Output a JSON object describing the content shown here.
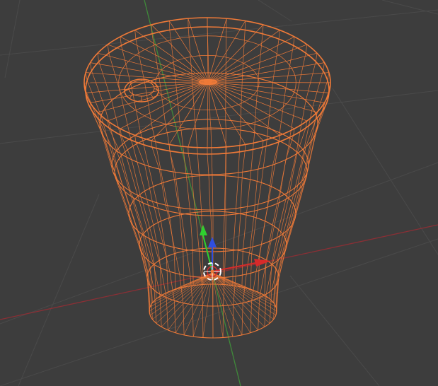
{
  "viewport": {
    "background": "#3d3d3d",
    "grid_color": "#4a4a4a",
    "axis_colors": {
      "x_axis_line": "#8a2f35",
      "y_axis_line": "#3f8a3a"
    }
  },
  "object": {
    "kind": "cylinder-mesh",
    "display": "wireframe",
    "selected": true,
    "wire_color": "#f07a38"
  },
  "gizmo": {
    "kind": "translate-gizmo",
    "x_color": "#d82a2a",
    "y_color": "#2fd02f",
    "z_color": "#2f4fe0",
    "cursor_colors": [
      "#ffffff",
      "#d82a2a"
    ]
  }
}
